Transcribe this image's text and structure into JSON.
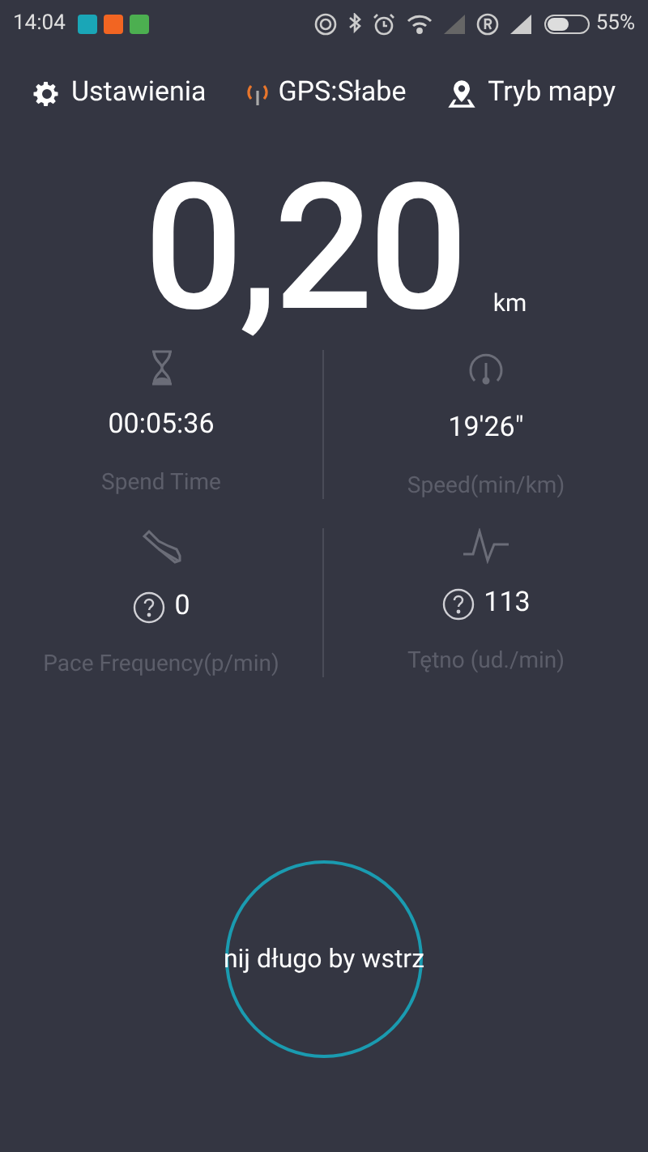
{
  "status_bar": {
    "time": "14:04",
    "battery": "55%"
  },
  "toolbar": [
    {
      "kind": "settings",
      "label": "Ustawienia"
    },
    {
      "kind": "gps",
      "label": "GPS:Słabe"
    },
    {
      "kind": "map",
      "label": "Tryb mapy"
    }
  ],
  "distance": {
    "value": "0,20",
    "unit": "km"
  },
  "stats": [
    {
      "kind": "time",
      "value": "00:05:36",
      "label": "Spend Time",
      "help": false
    },
    {
      "kind": "speed",
      "value": "19'26\"",
      "label": "Speed(min/km)",
      "help": false
    },
    {
      "kind": "steps",
      "value": "0",
      "label": "Pace Frequency(p/min)",
      "help": true
    },
    {
      "kind": "heart",
      "value": "113",
      "label": "Tętno (ud./min)",
      "help": true
    }
  ],
  "start_button": {
    "label": "nij długo by wstrz"
  }
}
